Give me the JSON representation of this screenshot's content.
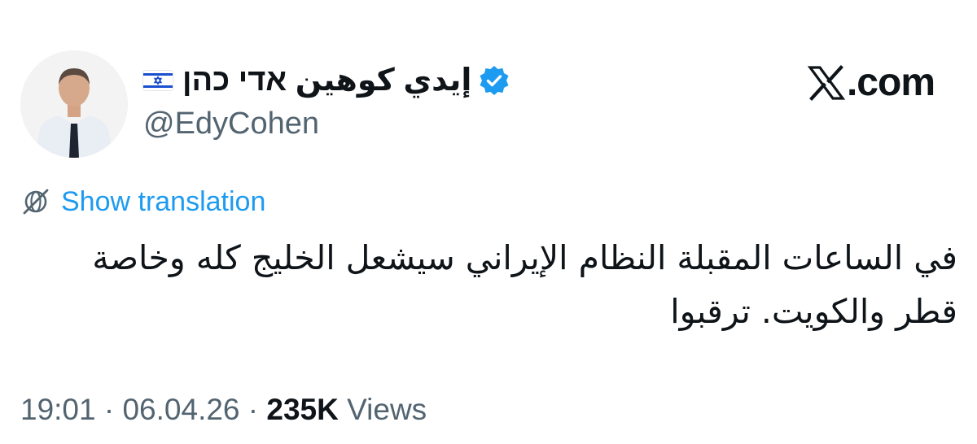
{
  "author": {
    "display_name": "إيدي كوهين אדי כהן",
    "handle": "@EdyCohen",
    "verified": true,
    "flag": "israel-flag",
    "avatar": "profile-photo"
  },
  "brand": {
    "label": ".com",
    "icon": "x-logo-icon"
  },
  "translation": {
    "label": "Show translation",
    "icon": "globe-translate-icon"
  },
  "tweet": {
    "text": "في الساعات المقبلة النظام الإيراني سيشعل الخليج كله وخاصة قطر والكويت. ترقبوا"
  },
  "meta": {
    "time": "19:01",
    "separator": " · ",
    "date": "06.04.26",
    "views_count": "235K",
    "views_label": " Views"
  },
  "colors": {
    "link": "#1d9bf0",
    "secondary_text": "#536471",
    "primary_text": "#0f1419",
    "verified_badge": "#1d9bf0"
  }
}
